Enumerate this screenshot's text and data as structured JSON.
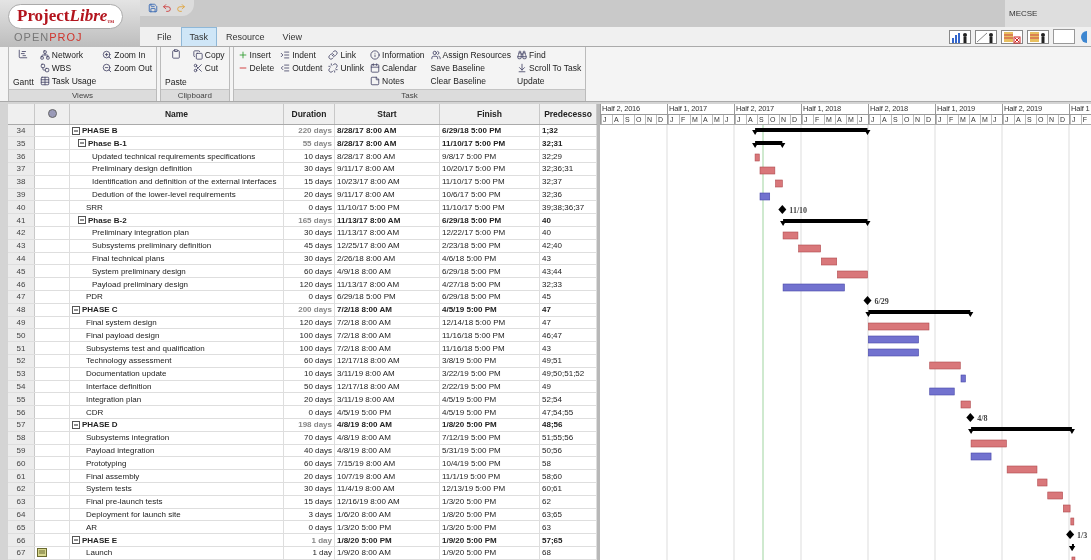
{
  "logo": {
    "name_a": "Project",
    "name_b": "Libre",
    "mark": "™",
    "sub_a": "OPEN",
    "sub_b": "PROJ"
  },
  "title_bar": {
    "workspace": "MECSE"
  },
  "tabs": [
    {
      "label": "File",
      "selected": false
    },
    {
      "label": "Task",
      "selected": true
    },
    {
      "label": "Resource",
      "selected": false
    },
    {
      "label": "View",
      "selected": false
    }
  ],
  "ribbon": [
    {
      "label": "Views",
      "columns": [
        [
          {
            "label": "Gantt",
            "kind": "large"
          }
        ],
        [
          {
            "label": "Network",
            "kind": "small"
          },
          {
            "label": "WBS",
            "kind": "small"
          },
          {
            "label": "Task Usage",
            "kind": "small"
          }
        ],
        [
          {
            "label": "Zoom In",
            "kind": "small"
          },
          {
            "label": "Zoom Out",
            "kind": "small"
          }
        ]
      ]
    },
    {
      "label": "Clipboard",
      "columns": [
        [
          {
            "label": "Paste",
            "kind": "large"
          }
        ],
        [
          {
            "label": "Copy",
            "kind": "small"
          },
          {
            "label": "Cut",
            "kind": "small"
          }
        ]
      ]
    },
    {
      "label": "Task",
      "columns": [
        [
          {
            "label": "Insert",
            "kind": "small"
          },
          {
            "label": "Delete",
            "kind": "small"
          }
        ],
        [
          {
            "label": "Indent",
            "kind": "small"
          },
          {
            "label": "Outdent",
            "kind": "small"
          }
        ],
        [
          {
            "label": "Link",
            "kind": "small"
          },
          {
            "label": "Unlink",
            "kind": "small"
          }
        ],
        [
          {
            "label": "Information",
            "kind": "small"
          },
          {
            "label": "Calendar",
            "kind": "small"
          },
          {
            "label": "Notes",
            "kind": "small"
          }
        ],
        [
          {
            "label": "Assign Resources",
            "kind": "small"
          },
          {
            "label": "Save Baseline",
            "kind": "text"
          },
          {
            "label": "Clear Baseline",
            "kind": "text"
          }
        ],
        [
          {
            "label": "Find",
            "kind": "small"
          },
          {
            "label": "Scroll To Task",
            "kind": "small"
          },
          {
            "label": "Update",
            "kind": "text"
          }
        ]
      ]
    }
  ],
  "columns": [
    "Name",
    "Duration",
    "Start",
    "Finish",
    "Predecesso"
  ],
  "timescale": [
    {
      "label": "Half 2, 2016",
      "months": [
        "J",
        "A",
        "S",
        "O",
        "N",
        "D"
      ]
    },
    {
      "label": "Half 1, 2017",
      "months": [
        "J",
        "F",
        "M",
        "A",
        "M",
        "J"
      ]
    },
    {
      "label": "Half 2, 2017",
      "months": [
        "J",
        "A",
        "S",
        "O",
        "N",
        "D"
      ]
    },
    {
      "label": "Half 1, 2018",
      "months": [
        "J",
        "F",
        "M",
        "A",
        "M",
        "J"
      ]
    },
    {
      "label": "Half 2, 2018",
      "months": [
        "J",
        "A",
        "S",
        "O",
        "N",
        "D"
      ]
    },
    {
      "label": "Half 1, 2019",
      "months": [
        "J",
        "F",
        "M",
        "A",
        "M",
        "J"
      ]
    },
    {
      "label": "Half 2, 2019",
      "months": [
        "J",
        "A",
        "S",
        "O",
        "N",
        "D"
      ]
    },
    {
      "label": "Half 1",
      "months": [
        "J",
        "F"
      ]
    }
  ],
  "tasks": [
    {
      "id": "34",
      "name": "PHASE B",
      "duration": "220 days",
      "start": "8/28/17 8:00 AM",
      "finish": "6/29/18 5:00 PM",
      "predecessors": "1;32",
      "kind": "summary",
      "expanded": true,
      "children": [
        {
          "id": "35",
          "name": "Phase B-1",
          "duration": "55 days",
          "start": "8/28/17 8:00 AM",
          "finish": "11/10/17 5:00 PM",
          "predecessors": "32;31",
          "kind": "summary",
          "expanded": true,
          "children": [
            {
              "id": "36",
              "name": "Updated technical requirements specifications",
              "duration": "10 days",
              "start": "8/28/17 8:00 AM",
              "finish": "9/8/17 5:00 PM",
              "predecessors": "32;29",
              "kind": "task",
              "critical": true
            },
            {
              "id": "37",
              "name": "Preliminary design definition",
              "duration": "30 days",
              "start": "9/11/17 8:00 AM",
              "finish": "10/20/17 5:00 PM",
              "predecessors": "32;36;31",
              "kind": "task",
              "critical": true
            },
            {
              "id": "38",
              "name": "Identification and definition of the external interfaces",
              "duration": "15 days",
              "start": "10/23/17 8:00 AM",
              "finish": "11/10/17 5:00 PM",
              "predecessors": "32;37",
              "kind": "task",
              "critical": true
            },
            {
              "id": "39",
              "name": "Dedution of the lower-level requirements",
              "duration": "20 days",
              "start": "9/11/17 8:00 AM",
              "finish": "10/6/17 5:00 PM",
              "predecessors": "32;36",
              "kind": "task",
              "critical": false
            }
          ]
        },
        {
          "id": "40",
          "name": "SRR",
          "duration": "0 days",
          "start": "11/10/17 5:00 PM",
          "finish": "11/10/17 5:00 PM",
          "predecessors": "39;38;36;37",
          "kind": "milestone",
          "gantt_label": "11/10"
        },
        {
          "id": "41",
          "name": "Phase B-2",
          "duration": "165 days",
          "start": "11/13/17 8:00 AM",
          "finish": "6/29/18 5:00 PM",
          "predecessors": "40",
          "kind": "summary",
          "expanded": true,
          "children": [
            {
              "id": "42",
              "name": "Preliminary integration plan",
              "duration": "30 days",
              "start": "11/13/17 8:00 AM",
              "finish": "12/22/17 5:00 PM",
              "predecessors": "40",
              "kind": "task",
              "critical": true
            },
            {
              "id": "43",
              "name": "Subsystems preliminary definition",
              "duration": "45 days",
              "start": "12/25/17 8:00 AM",
              "finish": "2/23/18 5:00 PM",
              "predecessors": "42;40",
              "kind": "task",
              "critical": true
            },
            {
              "id": "44",
              "name": "Final technical plans",
              "duration": "30 days",
              "start": "2/26/18 8:00 AM",
              "finish": "4/6/18 5:00 PM",
              "predecessors": "43",
              "kind": "task",
              "critical": true
            },
            {
              "id": "45",
              "name": "System preliminary design",
              "duration": "60 days",
              "start": "4/9/18 8:00 AM",
              "finish": "6/29/18 5:00 PM",
              "predecessors": "43;44",
              "kind": "task",
              "critical": true
            },
            {
              "id": "46",
              "name": "Payload preliminary design",
              "duration": "120 days",
              "start": "11/13/17 8:00 AM",
              "finish": "4/27/18 5:00 PM",
              "predecessors": "32;33",
              "kind": "task",
              "critical": false
            }
          ]
        },
        {
          "id": "47",
          "name": "PDR",
          "duration": "0 days",
          "start": "6/29/18 5:00 PM",
          "finish": "6/29/18 5:00 PM",
          "predecessors": "45",
          "kind": "milestone",
          "gantt_label": "6/29"
        }
      ]
    },
    {
      "id": "48",
      "name": "PHASE C",
      "duration": "200 days",
      "start": "7/2/18 8:00 AM",
      "finish": "4/5/19 5:00 PM",
      "predecessors": "47",
      "kind": "summary",
      "expanded": true,
      "children": [
        {
          "id": "49",
          "name": "Final system design",
          "duration": "120 days",
          "start": "7/2/18 8:00 AM",
          "finish": "12/14/18 5:00 PM",
          "predecessors": "47",
          "kind": "task",
          "critical": true
        },
        {
          "id": "50",
          "name": "Final payload design",
          "duration": "100 days",
          "start": "7/2/18 8:00 AM",
          "finish": "11/16/18 5:00 PM",
          "predecessors": "46;47",
          "kind": "task",
          "critical": false
        },
        {
          "id": "51",
          "name": "Subsystems test and qualification",
          "duration": "100 days",
          "start": "7/2/18 8:00 AM",
          "finish": "11/16/18 5:00 PM",
          "predecessors": "43",
          "kind": "task",
          "critical": false
        },
        {
          "id": "52",
          "name": "Technology assessment",
          "duration": "60 days",
          "start": "12/17/18 8:00 AM",
          "finish": "3/8/19 5:00 PM",
          "predecessors": "49;51",
          "kind": "task",
          "critical": true
        },
        {
          "id": "53",
          "name": "Documentation update",
          "duration": "10 days",
          "start": "3/11/19 8:00 AM",
          "finish": "3/22/19 5:00 PM",
          "predecessors": "49;50;51;52",
          "kind": "task",
          "critical": false
        },
        {
          "id": "54",
          "name": "Interface definition",
          "duration": "50 days",
          "start": "12/17/18 8:00 AM",
          "finish": "2/22/19 5:00 PM",
          "predecessors": "49",
          "kind": "task",
          "critical": false
        },
        {
          "id": "55",
          "name": "Integration plan",
          "duration": "20 days",
          "start": "3/11/19 8:00 AM",
          "finish": "4/5/19 5:00 PM",
          "predecessors": "52;54",
          "kind": "task",
          "critical": true
        },
        {
          "id": "56",
          "name": "CDR",
          "duration": "0 days",
          "start": "4/5/19 5:00 PM",
          "finish": "4/5/19 5:00 PM",
          "predecessors": "47;54;55",
          "kind": "milestone",
          "gantt_label": "4/8"
        }
      ]
    },
    {
      "id": "57",
      "name": "PHASE D",
      "duration": "198 days",
      "start": "4/8/19 8:00 AM",
      "finish": "1/8/20 5:00 PM",
      "predecessors": "48;56",
      "kind": "summary",
      "expanded": true,
      "children": [
        {
          "id": "58",
          "name": "Subsystems integration",
          "duration": "70 days",
          "start": "4/8/19 8:00 AM",
          "finish": "7/12/19 5:00 PM",
          "predecessors": "51;55;56",
          "kind": "task",
          "critical": true
        },
        {
          "id": "59",
          "name": "Payload integration",
          "duration": "40 days",
          "start": "4/8/19 8:00 AM",
          "finish": "5/31/19 5:00 PM",
          "predecessors": "50;56",
          "kind": "task",
          "critical": false
        },
        {
          "id": "60",
          "name": "Prototyping",
          "duration": "60 days",
          "start": "7/15/19 8:00 AM",
          "finish": "10/4/19 5:00 PM",
          "predecessors": "58",
          "kind": "task",
          "critical": true
        },
        {
          "id": "61",
          "name": "Final assembly",
          "duration": "20 days",
          "start": "10/7/19 8:00 AM",
          "finish": "11/1/19 5:00 PM",
          "predecessors": "58;60",
          "kind": "task",
          "critical": true
        },
        {
          "id": "62",
          "name": "System tests",
          "duration": "30 days",
          "start": "11/4/19 8:00 AM",
          "finish": "12/13/19 5:00 PM",
          "predecessors": "60;61",
          "kind": "task",
          "critical": true
        },
        {
          "id": "63",
          "name": "Final pre-launch tests",
          "duration": "15 days",
          "start": "12/16/19 8:00 AM",
          "finish": "1/3/20 5:00 PM",
          "predecessors": "62",
          "kind": "task",
          "critical": true
        },
        {
          "id": "64",
          "name": "Deployment for launch site",
          "duration": "3 days",
          "start": "1/6/20 8:00 AM",
          "finish": "1/8/20 5:00 PM",
          "predecessors": "63;65",
          "kind": "task",
          "critical": true
        },
        {
          "id": "65",
          "name": "AR",
          "duration": "0 days",
          "start": "1/3/20 5:00 PM",
          "finish": "1/3/20 5:00 PM",
          "predecessors": "63",
          "kind": "milestone",
          "gantt_label": "1/3"
        }
      ]
    },
    {
      "id": "66",
      "name": "PHASE E",
      "duration": "1 day",
      "start": "1/8/20 5:00 PM",
      "finish": "1/9/20 5:00 PM",
      "predecessors": "57;65",
      "kind": "summary",
      "expanded": true,
      "children": [
        {
          "id": "67",
          "name": "Launch",
          "duration": "1 day",
          "start": "1/9/20 8:00 AM",
          "finish": "1/9/20 5:00 PM",
          "predecessors": "68",
          "kind": "task",
          "critical": true,
          "indicator": true
        }
      ]
    }
  ]
}
